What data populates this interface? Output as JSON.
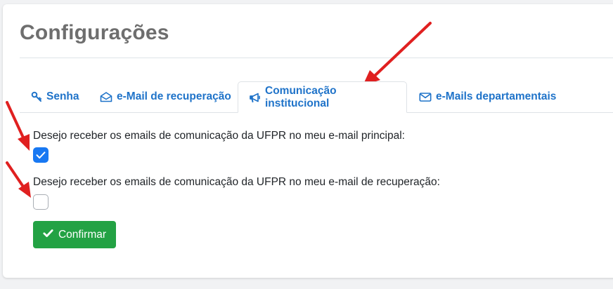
{
  "page": {
    "title": "Configurações"
  },
  "tabs": [
    {
      "label": "Senha",
      "icon": "key-icon",
      "active": false
    },
    {
      "label": "e-Mail de recuperação",
      "icon": "envelope-open-icon",
      "active": false
    },
    {
      "label": "Comunicação institucional",
      "icon": "bullhorn-icon",
      "active": true
    },
    {
      "label": "e-Mails departamentais",
      "icon": "envelope-icon",
      "active": false
    }
  ],
  "form": {
    "primary_label": "Desejo receber os emails de comunicação da UFPR no meu e-mail principal:",
    "primary_checked": true,
    "recovery_label": "Desejo receber os emails de comunicação da UFPR no meu e-mail de recuperação:",
    "recovery_checked": false,
    "submit_label": "Confirmar",
    "submit_icon": "check-icon"
  },
  "colors": {
    "tab_text": "#1f73c9",
    "checkbox_checked": "#1878f2",
    "button": "#23a244",
    "annotation_arrow": "#e02020"
  }
}
